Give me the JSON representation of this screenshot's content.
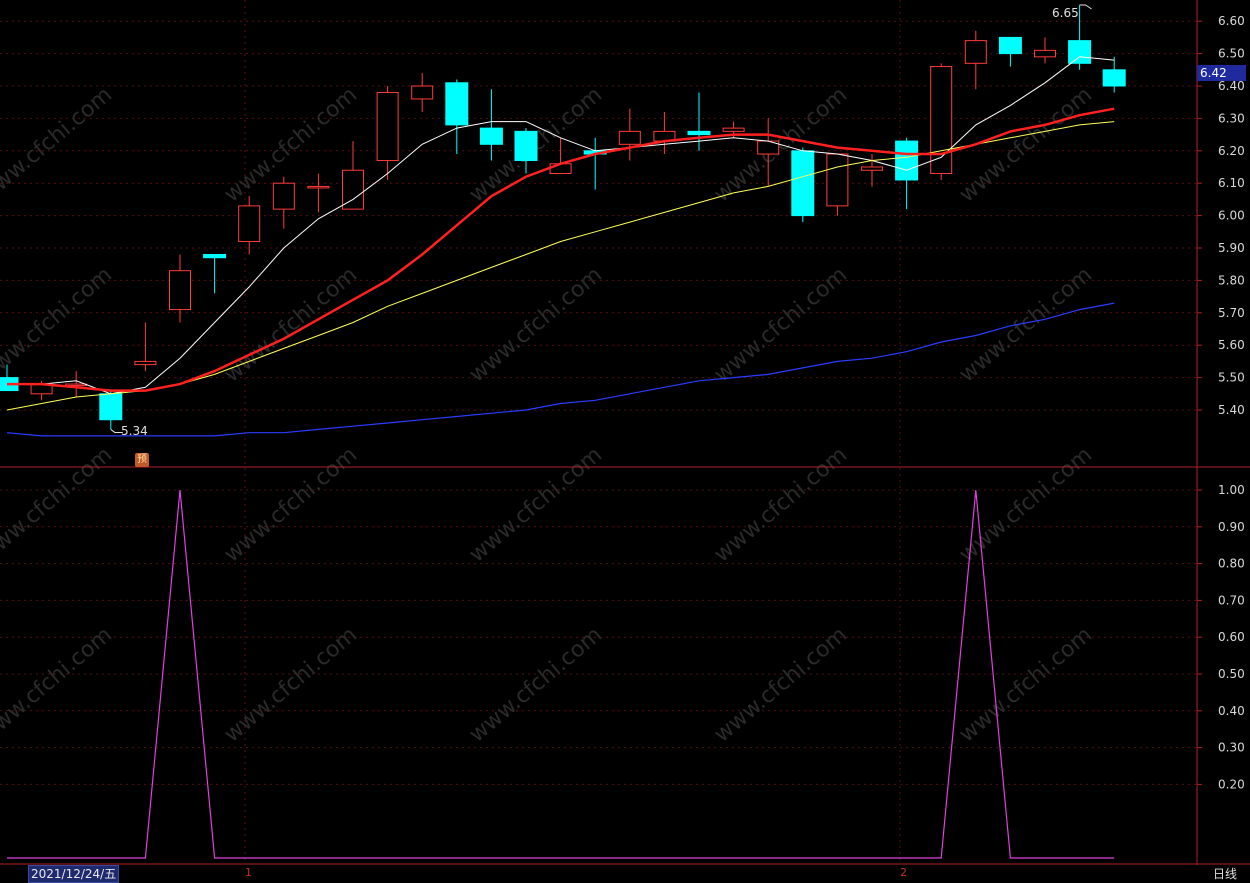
{
  "main": {
    "y_ticks": [
      "6.60",
      "6.50",
      "6.40",
      "6.30",
      "6.20",
      "6.10",
      "6.00",
      "5.90",
      "5.80",
      "5.70",
      "5.60",
      "5.50",
      "5.40"
    ],
    "current_price": "6.42",
    "high_label": "6.65",
    "low_label": "5.34",
    "badge": "预"
  },
  "sub": {
    "y_ticks": [
      "1.00",
      "0.90",
      "0.80",
      "0.70",
      "0.60",
      "0.50",
      "0.40",
      "0.30",
      "0.20"
    ]
  },
  "footer": {
    "date": "2021/12/24/五",
    "month1": "1",
    "month2": "2",
    "period": "日线"
  },
  "watermark": "www.cfchi.com",
  "colors": {
    "up": "#ff3c3c",
    "down": "#00ffff",
    "ma5": "#ffffff",
    "ma10": "#ffff5a",
    "ma20": "#ff2020",
    "ma60": "#2a3cff",
    "signal": "#e040e0",
    "axis": "#b02020"
  },
  "chart_data": [
    {
      "type": "candlestick",
      "ylim": [
        5.34,
        6.65
      ],
      "candles": [
        {
          "o": 5.5,
          "h": 5.54,
          "l": 5.46,
          "c": 5.46
        },
        {
          "o": 5.45,
          "h": 5.49,
          "l": 5.43,
          "c": 5.48
        },
        {
          "o": 5.48,
          "h": 5.52,
          "l": 5.44,
          "c": 5.48
        },
        {
          "o": 5.45,
          "h": 5.46,
          "l": 5.34,
          "c": 5.37
        },
        {
          "o": 5.54,
          "h": 5.67,
          "l": 5.52,
          "c": 5.55
        },
        {
          "o": 5.71,
          "h": 5.88,
          "l": 5.67,
          "c": 5.83
        },
        {
          "o": 5.88,
          "h": 5.88,
          "l": 5.76,
          "c": 5.87
        },
        {
          "o": 5.92,
          "h": 6.06,
          "l": 5.88,
          "c": 6.03
        },
        {
          "o": 6.02,
          "h": 6.12,
          "l": 5.96,
          "c": 6.1
        },
        {
          "o": 6.09,
          "h": 6.13,
          "l": 6.01,
          "c": 6.09
        },
        {
          "o": 6.02,
          "h": 6.23,
          "l": 6.02,
          "c": 6.14
        },
        {
          "o": 6.17,
          "h": 6.4,
          "l": 6.11,
          "c": 6.38
        },
        {
          "o": 6.36,
          "h": 6.44,
          "l": 6.32,
          "c": 6.4
        },
        {
          "o": 6.41,
          "h": 6.42,
          "l": 6.19,
          "c": 6.28
        },
        {
          "o": 6.27,
          "h": 6.39,
          "l": 6.17,
          "c": 6.22
        },
        {
          "o": 6.26,
          "h": 6.27,
          "l": 6.13,
          "c": 6.17
        },
        {
          "o": 6.13,
          "h": 6.24,
          "l": 6.13,
          "c": 6.16
        },
        {
          "o": 6.2,
          "h": 6.24,
          "l": 6.08,
          "c": 6.19
        },
        {
          "o": 6.22,
          "h": 6.33,
          "l": 6.17,
          "c": 6.26
        },
        {
          "o": 6.23,
          "h": 6.32,
          "l": 6.19,
          "c": 6.26
        },
        {
          "o": 6.26,
          "h": 6.38,
          "l": 6.2,
          "c": 6.25
        },
        {
          "o": 6.26,
          "h": 6.29,
          "l": 6.24,
          "c": 6.27
        },
        {
          "o": 6.19,
          "h": 6.3,
          "l": 6.09,
          "c": 6.23
        },
        {
          "o": 6.2,
          "h": 6.21,
          "l": 5.98,
          "c": 6.0
        },
        {
          "o": 6.03,
          "h": 6.17,
          "l": 6.0,
          "c": 6.19
        },
        {
          "o": 6.14,
          "h": 6.19,
          "l": 6.09,
          "c": 6.15
        },
        {
          "o": 6.23,
          "h": 6.24,
          "l": 6.02,
          "c": 6.11
        },
        {
          "o": 6.13,
          "h": 6.47,
          "l": 6.11,
          "c": 6.46
        },
        {
          "o": 6.47,
          "h": 6.57,
          "l": 6.39,
          "c": 6.54
        },
        {
          "o": 6.55,
          "h": 6.55,
          "l": 6.46,
          "c": 6.5
        },
        {
          "o": 6.49,
          "h": 6.55,
          "l": 6.47,
          "c": 6.51
        },
        {
          "o": 6.54,
          "h": 6.65,
          "l": 6.45,
          "c": 6.47
        },
        {
          "o": 6.45,
          "h": 6.49,
          "l": 6.38,
          "c": 6.4
        }
      ],
      "ma": [
        {
          "name": "MA5",
          "color": "#ffffff",
          "values": [
            5.48,
            5.48,
            5.49,
            5.45,
            5.47,
            5.56,
            5.67,
            5.78,
            5.9,
            5.99,
            6.05,
            6.13,
            6.22,
            6.27,
            6.29,
            6.29,
            6.24,
            6.2,
            6.21,
            6.22,
            6.23,
            6.24,
            6.23,
            6.2,
            6.19,
            6.17,
            6.14,
            6.18,
            6.28,
            6.34,
            6.41,
            6.49,
            6.48
          ]
        },
        {
          "name": "MA10",
          "color": "#ffff5a",
          "values": [
            5.4,
            5.42,
            5.44,
            5.45,
            5.46,
            5.48,
            5.51,
            5.55,
            5.59,
            5.63,
            5.67,
            5.72,
            5.76,
            5.8,
            5.84,
            5.88,
            5.92,
            5.95,
            5.98,
            6.01,
            6.04,
            6.07,
            6.09,
            6.12,
            6.15,
            6.17,
            6.18,
            6.2,
            6.22,
            6.24,
            6.26,
            6.28,
            6.29
          ]
        },
        {
          "name": "MA20",
          "color": "#ff2020",
          "values": [
            5.48,
            5.48,
            5.47,
            5.46,
            5.46,
            5.48,
            5.52,
            5.57,
            5.62,
            5.68,
            5.74,
            5.8,
            5.88,
            5.97,
            6.06,
            6.12,
            6.16,
            6.19,
            6.21,
            6.23,
            6.24,
            6.25,
            6.25,
            6.23,
            6.21,
            6.2,
            6.19,
            6.19,
            6.22,
            6.26,
            6.28,
            6.31,
            6.33
          ]
        },
        {
          "name": "MA60",
          "color": "#2a3cff",
          "values": [
            5.33,
            5.32,
            5.32,
            5.32,
            5.32,
            5.32,
            5.32,
            5.33,
            5.33,
            5.34,
            5.35,
            5.36,
            5.37,
            5.38,
            5.39,
            5.4,
            5.42,
            5.43,
            5.45,
            5.47,
            5.49,
            5.5,
            5.51,
            5.53,
            5.55,
            5.56,
            5.58,
            5.61,
            5.63,
            5.66,
            5.68,
            5.71,
            5.73
          ]
        }
      ]
    },
    {
      "type": "line",
      "ylim": [
        0,
        1
      ],
      "series": [
        {
          "color": "#e040e0",
          "values": [
            0,
            0,
            0,
            0,
            0,
            1,
            0,
            0,
            0,
            0,
            0,
            0,
            0,
            0,
            0,
            0,
            0,
            0,
            0,
            0,
            0,
            0,
            0,
            0,
            0,
            0,
            0,
            0,
            1,
            0,
            0,
            0,
            0
          ]
        }
      ]
    }
  ]
}
